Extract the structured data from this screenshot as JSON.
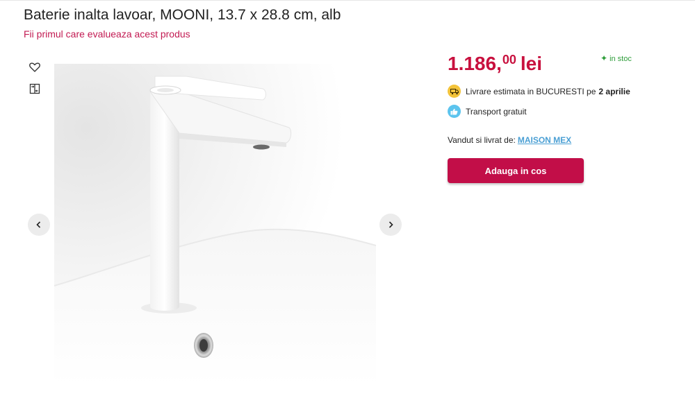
{
  "product": {
    "title": "Baterie inalta lavoar, MOONI, 13.7 x 28.8 cm, alb",
    "review_link": "Fii primul care evalueaza acest produs"
  },
  "gallery": {
    "side_icons": [
      "heart-icon",
      "compare-icon"
    ],
    "prev_icon": "chevron-left-icon",
    "next_icon": "chevron-right-icon"
  },
  "price": {
    "integer": "1.186,",
    "decimals": "00",
    "currency": "lei",
    "color": "#c8103e"
  },
  "stock": {
    "icon": "sparkle-icon",
    "label": "in stoc",
    "color": "#2e9d3a"
  },
  "delivery": {
    "icon": "truck-icon",
    "text": "Livrare estimata in BUCURESTI pe",
    "date": "2 aprilie"
  },
  "shipping": {
    "icon": "thumbs-up-icon",
    "text": "Transport gratuit"
  },
  "seller": {
    "label": "Vandut si livrat de:",
    "name": "MAISON MEX"
  },
  "cart": {
    "button_label": "Adauga in cos",
    "color": "#c20e48"
  }
}
